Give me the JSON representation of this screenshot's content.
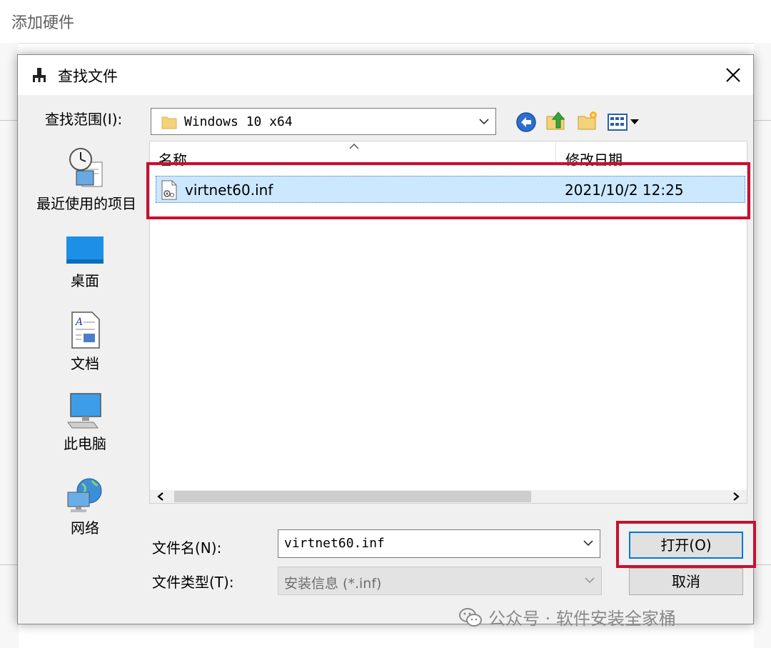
{
  "parent_window": {
    "title": "添加硬件"
  },
  "dialog": {
    "title": "查找文件",
    "close_icon": "close-icon",
    "look_in": {
      "label": "查找范围(I):",
      "value": "Windows 10 x64"
    },
    "toolbar": [
      "back-icon",
      "up-folder-icon",
      "new-folder-icon",
      "view-menu-icon"
    ],
    "places": [
      {
        "label": "最近使用的项目",
        "icon": "recent-items-icon"
      },
      {
        "label": "桌面",
        "icon": "desktop-icon"
      },
      {
        "label": "文档",
        "icon": "documents-icon"
      },
      {
        "label": "此电脑",
        "icon": "this-pc-icon"
      },
      {
        "label": "网络",
        "icon": "network-icon"
      }
    ],
    "file_list": {
      "columns": {
        "name": "名称",
        "date": "修改日期"
      },
      "files": [
        {
          "name": "virtnet60.inf",
          "modified": "2021/10/2 12:25",
          "icon": "setup-info-file-icon",
          "selected": true
        }
      ]
    },
    "file_name": {
      "label": "文件名(N):",
      "value": "virtnet60.inf"
    },
    "file_type": {
      "label": "文件类型(T):",
      "value": "安装信息 (*.inf)"
    },
    "buttons": {
      "open": "打开(O)",
      "cancel": "取消"
    },
    "highlight_color": "#c8102e",
    "selection_color": "#cce8ff"
  },
  "watermark": {
    "text": "公众号 · 软件安装全家桶"
  }
}
